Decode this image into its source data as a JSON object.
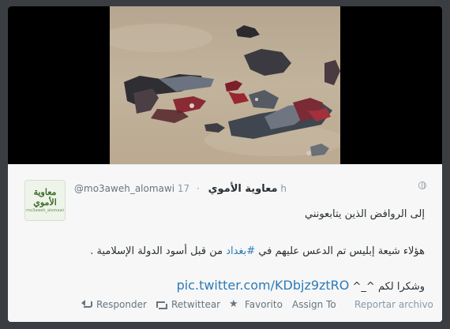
{
  "media": {
    "alt_icon": "photo-image"
  },
  "tweet": {
    "display_name": "معاوية الأموي",
    "handle": "@mo3aweh_alomawi",
    "separator": "·",
    "time": "17 h",
    "avatar_logo": {
      "line1": "معاوية",
      "line2": "الأموي",
      "line3": "mo3aweh_alomawi"
    },
    "globe_icon": "globe-icon",
    "line1": "إلى الروافض الذين يتابعونني",
    "line2_before": "هؤلاء شيعة إبليس تم الدعس عليهم في ",
    "line2_hashtag": "#بغداد",
    "line2_after": " من قبل أسود الدولة الإسلامية .",
    "line3_text": "وشكرا لكم ^_^ ",
    "line3_link": "pic.twitter.com/KDbjz9ztRO"
  },
  "actions": {
    "reply": "Responder",
    "retweet": "Retwittear",
    "favorite": "Favorito",
    "assign": "Assign To",
    "report": "Reportar archivo"
  }
}
